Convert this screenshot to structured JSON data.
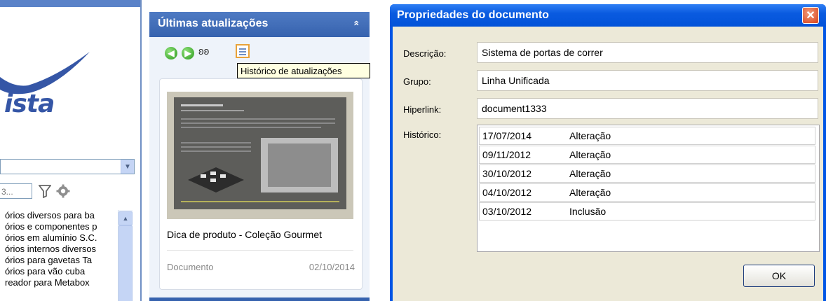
{
  "left_panel": {
    "logo_text": "ista",
    "search_placeholder": "3...",
    "list_items": [
      "órios diversos para ba",
      "órios e componentes p",
      "órios em alumínio S.C.",
      "órios internos diversos",
      "órios para gavetas Ta",
      "órios para vão cuba",
      "reador para Metabox"
    ]
  },
  "updates_panel": {
    "title": "Últimas atualizações",
    "collapse_glyph": "»",
    "tooltip": "Histórico de atualizações",
    "card": {
      "title": "Dica de produto - Coleção Gourmet",
      "type": "Documento",
      "date": "02/10/2014"
    }
  },
  "dialog": {
    "title": "Propriedades do documento",
    "close_glyph": "✕",
    "fields": {
      "descricao_label": "Descrição:",
      "descricao_value": "Sistema de portas de correr",
      "grupo_label": "Grupo:",
      "grupo_value": "Linha Unificada",
      "hiperlink_label": "Hiperlink:",
      "hiperlink_value": "document1333",
      "historico_label": "Histórico:"
    },
    "history": [
      {
        "date": "17/07/2014",
        "action": "Alteração"
      },
      {
        "date": "09/11/2012",
        "action": "Alteração"
      },
      {
        "date": "30/10/2012",
        "action": "Alteração"
      },
      {
        "date": "04/10/2012",
        "action": "Alteração"
      },
      {
        "date": "03/10/2012",
        "action": "Inclusão"
      }
    ],
    "ok_label": "OK"
  },
  "colors": {
    "xp_blue": "#0055e5",
    "panel_header": "#3662ae",
    "dialog_body": "#ece9d8",
    "tooltip_bg": "#ffffe1"
  }
}
